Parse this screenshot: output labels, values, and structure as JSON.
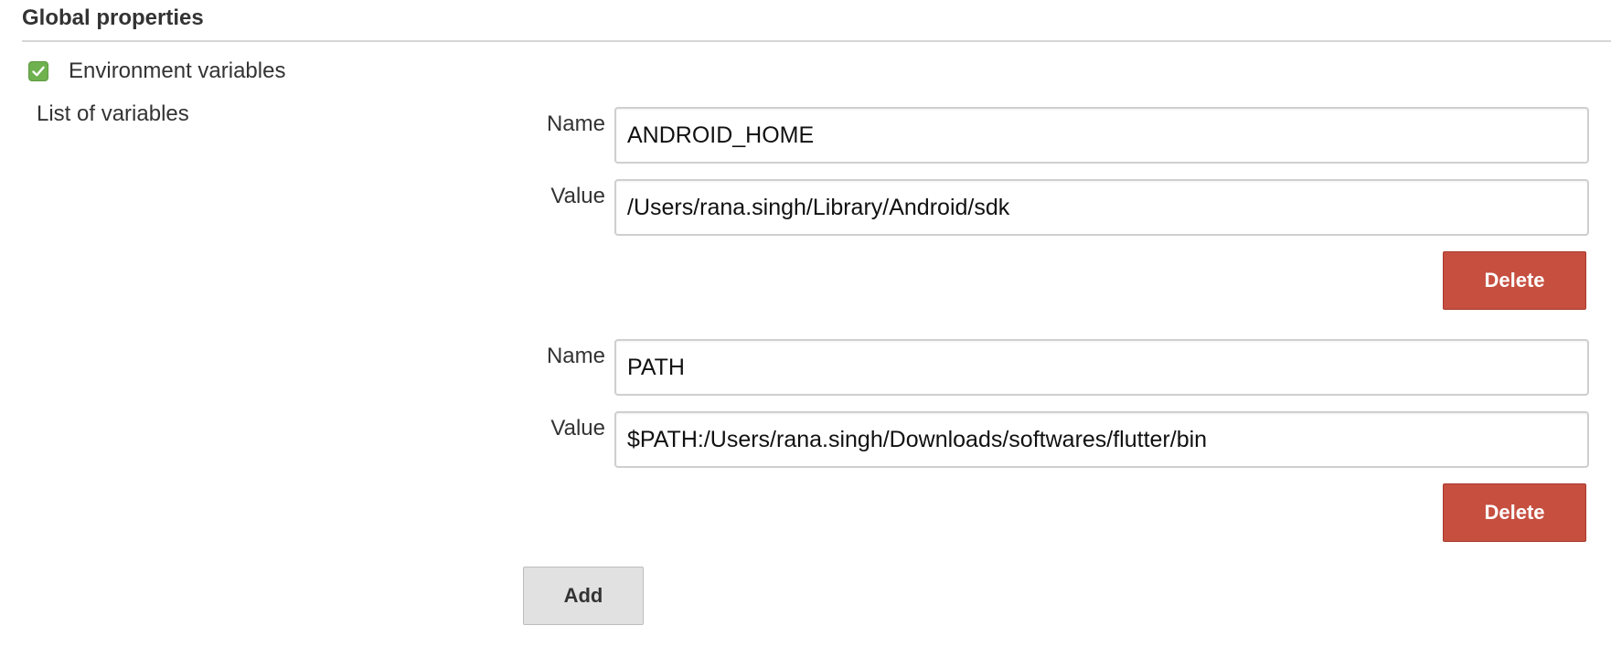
{
  "section": {
    "title": "Global properties"
  },
  "env_vars": {
    "checkbox_label": "Environment variables",
    "checked": true,
    "list_label": "List of variables",
    "items": [
      {
        "name_label": "Name",
        "name_value": "ANDROID_HOME",
        "value_label": "Value",
        "value_value": "/Users/rana.singh/Library/Android/sdk",
        "delete_label": "Delete"
      },
      {
        "name_label": "Name",
        "name_value": "PATH",
        "value_label": "Value",
        "value_value": "$PATH:/Users/rana.singh/Downloads/softwares/flutter/bin",
        "delete_label": "Delete"
      }
    ],
    "add_label": "Add"
  },
  "colors": {
    "delete_button": "#c64f40",
    "checkbox_checked": "#6fb04f",
    "add_button": "#e1e1e1"
  },
  "icons": {
    "checkbox": "checkmark-icon"
  }
}
